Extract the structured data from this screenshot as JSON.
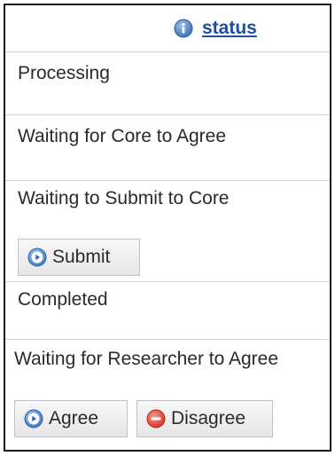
{
  "header": {
    "status_link": "status",
    "icon": "info-icon"
  },
  "rows": [
    {
      "label": "Processing"
    },
    {
      "label": "Waiting for Core to Agree"
    },
    {
      "label": "Waiting to Submit to Core",
      "button": {
        "label": "Submit",
        "icon": "play-circle-icon"
      }
    },
    {
      "label": "Completed"
    },
    {
      "label": "Waiting for Researcher to Agree",
      "buttons": [
        {
          "label": "Agree",
          "icon": "play-circle-icon"
        },
        {
          "label": "Disagree",
          "icon": "minus-circle-icon"
        }
      ]
    }
  ],
  "colors": {
    "link": "#1c4f9c",
    "icon_blue": "#3f79c4",
    "disagree_red": "#d9372b"
  }
}
